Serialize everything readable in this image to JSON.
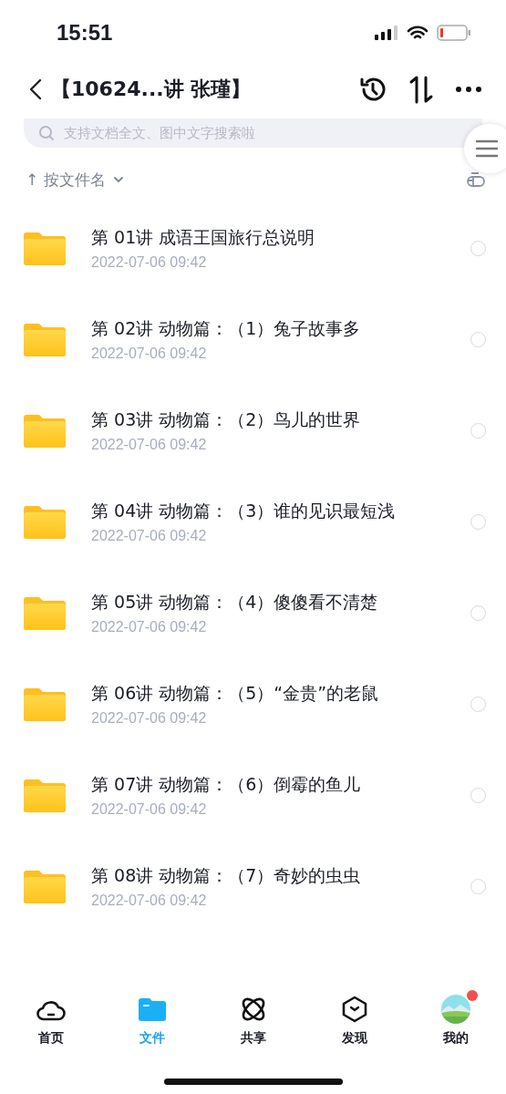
{
  "status_bar": {
    "time": "15:51"
  },
  "header": {
    "title": "【10624...讲 张瑾】"
  },
  "search": {
    "placeholder": "支持文档全文、图中文字搜索啦"
  },
  "sort": {
    "arrow": "↑",
    "label": "按文件名"
  },
  "files": [
    {
      "name": "第 01讲 成语王国旅行总说明",
      "date": "2022-07-06 09:42",
      "selected": false
    },
    {
      "name": "第 02讲 动物篇：（1）兔子故事多",
      "date": "2022-07-06 09:42",
      "selected": false
    },
    {
      "name": "第 03讲 动物篇：（2）鸟儿的世界",
      "date": "2022-07-06 09:42",
      "selected": false
    },
    {
      "name": "第 04讲 动物篇：（3）谁的见识最短浅",
      "date": "2022-07-06 09:42",
      "selected": false
    },
    {
      "name": "第 05讲 动物篇：（4）傻傻看不清楚",
      "date": "2022-07-06 09:42",
      "selected": false
    },
    {
      "name": "第 06讲 动物篇：（5）“金贵”的老鼠",
      "date": "2022-07-06 09:42",
      "selected": false
    },
    {
      "name": "第 07讲 动物篇：（6）倒霉的鱼儿",
      "date": "2022-07-06 09:42",
      "selected": false
    },
    {
      "name": "第 08讲 动物篇：（7）奇妙的虫虫",
      "date": "2022-07-06 09:42",
      "selected": false
    }
  ],
  "tabs": [
    {
      "kind": "cloud",
      "label": "首页",
      "selected": false
    },
    {
      "kind": "folder",
      "label": "文件",
      "selected": true
    },
    {
      "kind": "orbit",
      "label": "共享",
      "selected": false
    },
    {
      "kind": "hexagon",
      "label": "发现",
      "selected": false
    },
    {
      "kind": "avatar",
      "label": "我的",
      "selected": false,
      "badge": true
    }
  ]
}
